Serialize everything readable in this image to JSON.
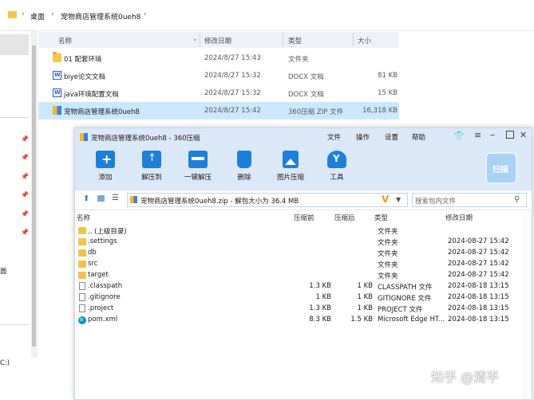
{
  "colors": {
    "accent": "#1e7fd8",
    "toolbar_bg": "#dbe8f8",
    "selected_row": "#cce8ff",
    "folder": "#f4c14a"
  },
  "explorer": {
    "breadcrumb": [
      "桌面",
      "宠物商店管理系统0ueh8"
    ],
    "columns": {
      "name": "名称",
      "modified": "修改日期",
      "type": "类型",
      "size": "大小"
    },
    "files": [
      {
        "name": "01 配套环境",
        "modified": "2024/8/27 15:43",
        "type": "文件夹",
        "size": "",
        "icon": "folder-icon"
      },
      {
        "name": "biye论文文档",
        "modified": "2024/8/27 15:32",
        "type": "DOCX 文档",
        "size": "81 KB",
        "icon": "docx-icon"
      },
      {
        "name": "java环境配置文档",
        "modified": "2024/8/27 15:32",
        "type": "DOCX 文档",
        "size": "15 KB",
        "icon": "docx-icon"
      },
      {
        "name": "宠物商店管理系统0ueh8",
        "modified": "2024/8/27 15:42",
        "type": "360压缩 ZIP 文件",
        "size": "16,318 KB",
        "icon": "zip-icon",
        "selected": true
      }
    ],
    "nav_fragments": [
      "面",
      "C:)"
    ]
  },
  "archive": {
    "title": "宠物商店管理系统0ueh8 - 360压缩",
    "menu": [
      "文件",
      "操作",
      "设置",
      "帮助"
    ],
    "toolbar": [
      "添加",
      "解压到",
      "一键解压",
      "删除",
      "图片压缩",
      "工具"
    ],
    "scan_label": "扫描",
    "address": "宠物商店管理系统0ueh8.zip - 解包大小为 36.4 MB",
    "search_placeholder": "搜索包内文件",
    "columns": {
      "name": "名称",
      "packed": "压缩前",
      "unpacked": "压缩后",
      "type": "类型",
      "modified": "修改日期"
    },
    "entries": [
      {
        "name": ".. (上级目录)",
        "packed": "",
        "unpacked": "",
        "type": "文件夹",
        "modified": "",
        "icon": "folder-icon"
      },
      {
        "name": ".settings",
        "packed": "",
        "unpacked": "",
        "type": "文件夹",
        "modified": "2024-08-27 15:42",
        "icon": "folder-icon"
      },
      {
        "name": "db",
        "packed": "",
        "unpacked": "",
        "type": "文件夹",
        "modified": "2024-08-27 15:42",
        "icon": "folder-icon"
      },
      {
        "name": "src",
        "packed": "",
        "unpacked": "",
        "type": "文件夹",
        "modified": "2024-08-27 15:42",
        "icon": "folder-icon"
      },
      {
        "name": "target",
        "packed": "",
        "unpacked": "",
        "type": "文件夹",
        "modified": "2024-08-27 15:42",
        "icon": "folder-icon"
      },
      {
        "name": ".classpath",
        "packed": "1.3 KB",
        "unpacked": "1 KB",
        "type": "CLASSPATH 文件",
        "modified": "2024-08-18 13:15",
        "icon": "file-icon"
      },
      {
        "name": ".gitignore",
        "packed": "1 KB",
        "unpacked": "1 KB",
        "type": "GITIGNORE 文件",
        "modified": "2024-08-18 13:15",
        "icon": "file-icon"
      },
      {
        "name": ".project",
        "packed": "1.3 KB",
        "unpacked": "1 KB",
        "type": "PROJECT 文件",
        "modified": "2024-08-18 13:15",
        "icon": "file-icon"
      },
      {
        "name": "pom.xml",
        "packed": "8.3 KB",
        "unpacked": "1.5 KB",
        "type": "Microsoft Edge HT...",
        "modified": "2024-08-18 13:15",
        "icon": "edge-icon"
      }
    ]
  },
  "watermark": "知乎 @清平"
}
